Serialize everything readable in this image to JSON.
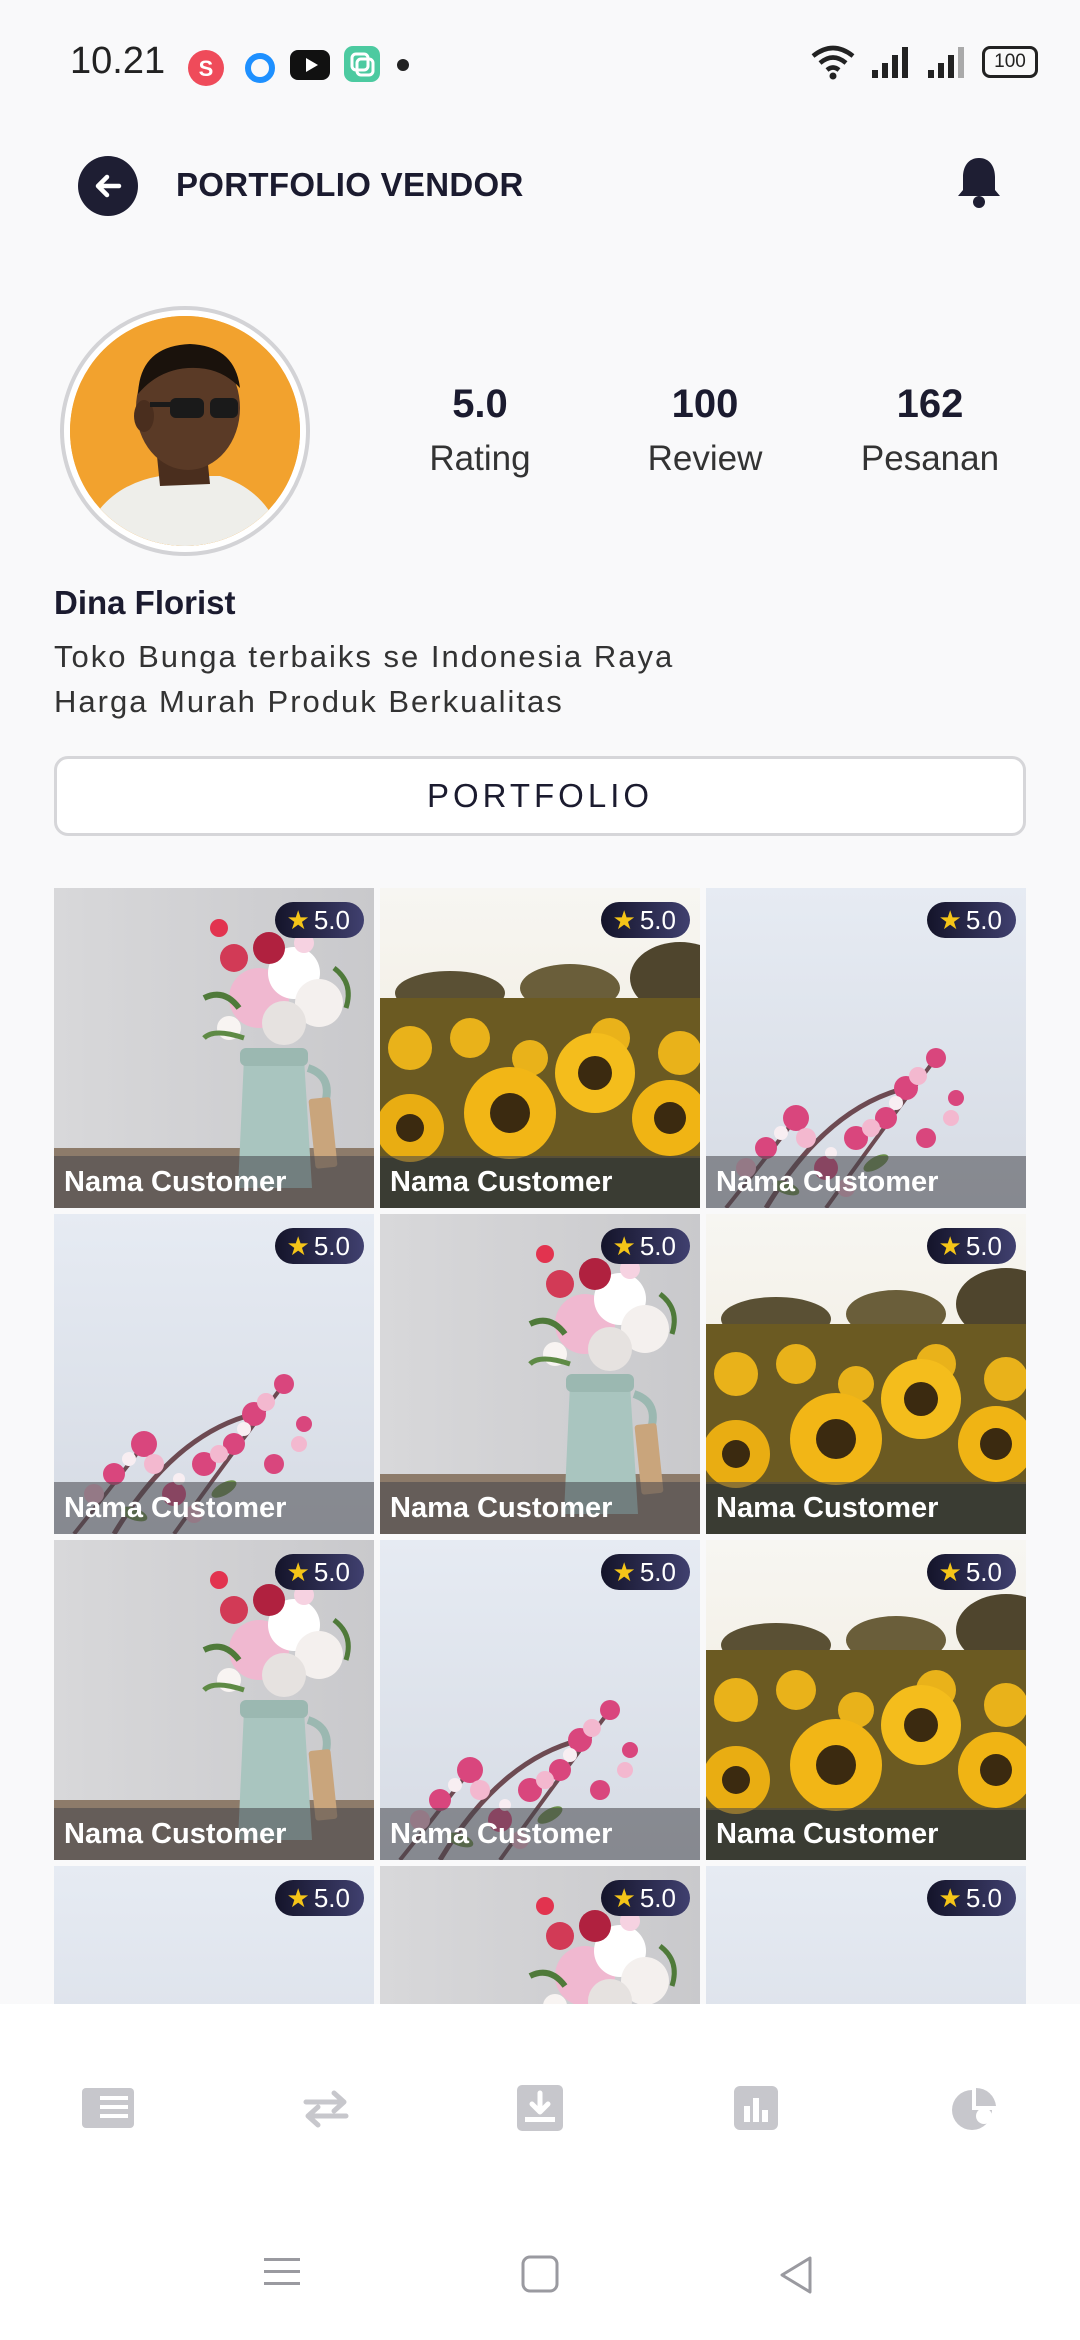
{
  "status_bar": {
    "time": "10.21",
    "battery": "100",
    "notification_icons": [
      "s-app-icon",
      "ring-app-icon",
      "youtube-icon",
      "gallery-app-icon",
      "dot-icon"
    ],
    "right_icons": [
      "wifi-icon",
      "signal-icon",
      "signal-icon",
      "battery-icon"
    ]
  },
  "header": {
    "title": "PORTFOLIO VENDOR",
    "back_icon": "arrow-left-icon",
    "bell_icon": "bell-icon"
  },
  "profile": {
    "name": "Dina Florist",
    "bio_line1": "Toko Bunga terbaiks se Indonesia Raya",
    "bio_line2": "Harga Murah Produk Berkualitas",
    "stats": [
      {
        "value": "5.0",
        "label": "Rating"
      },
      {
        "value": "100",
        "label": "Review"
      },
      {
        "value": "162",
        "label": "Pesanan"
      }
    ]
  },
  "portfolio_button": "PORTFOLIO",
  "grid": {
    "items": [
      {
        "rating": "5.0",
        "caption": "Nama Customer",
        "photo": "vase-bouquet"
      },
      {
        "rating": "5.0",
        "caption": "Nama Customer",
        "photo": "sunflowers"
      },
      {
        "rating": "5.0",
        "caption": "Nama Customer",
        "photo": "pink-blossoms"
      },
      {
        "rating": "5.0",
        "caption": "Nama Customer",
        "photo": "pink-blossoms"
      },
      {
        "rating": "5.0",
        "caption": "Nama Customer",
        "photo": "vase-bouquet"
      },
      {
        "rating": "5.0",
        "caption": "Nama Customer",
        "photo": "sunflowers"
      },
      {
        "rating": "5.0",
        "caption": "Nama Customer",
        "photo": "vase-bouquet"
      },
      {
        "rating": "5.0",
        "caption": "Nama Customer",
        "photo": "pink-blossoms"
      },
      {
        "rating": "5.0",
        "caption": "Nama Customer",
        "photo": "sunflowers"
      },
      {
        "rating": "5.0",
        "caption": "",
        "photo": "pink-blossoms"
      },
      {
        "rating": "5.0",
        "caption": "",
        "photo": "vase-bouquet"
      },
      {
        "rating": "5.0",
        "caption": "",
        "photo": "pink-blossoms"
      }
    ]
  },
  "bottom_nav": {
    "items": [
      "newspaper-icon",
      "transfer-icon",
      "inbox-download-icon",
      "bar-chart-icon",
      "pie-chart-icon"
    ]
  },
  "system_nav": {
    "items": [
      "menu-icon",
      "home-square-icon",
      "back-triangle-icon"
    ]
  }
}
